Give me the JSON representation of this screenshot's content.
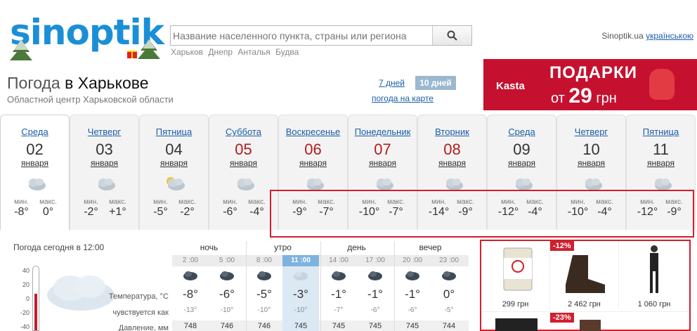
{
  "header": {
    "logo": "sinoptik",
    "search_placeholder": "Название населенного пункта, страны или региона",
    "quick_links": [
      "Харьков",
      "Днепр",
      "Анталья",
      "Будва"
    ],
    "site": "Sinoptik.ua",
    "lang_link": "українською"
  },
  "city": {
    "title_prefix": "Погода",
    "title_main": "в Харькове",
    "subtitle": "Областной центр Харьковской области"
  },
  "tabs": {
    "seven": "7 дней",
    "ten": "10 дней",
    "map": "погода на карте"
  },
  "ad": {
    "brand": "Kasta",
    "title": "ПОДАРКИ",
    "sub_prefix": "от",
    "sub_number": "29",
    "sub_suffix": "грн"
  },
  "days": [
    {
      "name": "Среда",
      "num": "02",
      "month": "января",
      "min": "-8°",
      "max": "0°",
      "red": false
    },
    {
      "name": "Четверг",
      "num": "03",
      "month": "января",
      "min": "-2°",
      "max": "+1°",
      "red": false
    },
    {
      "name": "Пятница",
      "num": "04",
      "month": "января",
      "min": "-5°",
      "max": "-2°",
      "red": false
    },
    {
      "name": "Суббота",
      "num": "05",
      "month": "января",
      "min": "-6°",
      "max": "-4°",
      "red": true
    },
    {
      "name": "Воскресенье",
      "num": "06",
      "month": "января",
      "min": "-9°",
      "max": "-7°",
      "red": true
    },
    {
      "name": "Понедельник",
      "num": "07",
      "month": "января",
      "min": "-10°",
      "max": "-7°",
      "red": true
    },
    {
      "name": "Вторник",
      "num": "08",
      "month": "января",
      "min": "-14°",
      "max": "-9°",
      "red": true
    },
    {
      "name": "Среда",
      "num": "09",
      "month": "января",
      "min": "-12°",
      "max": "-4°",
      "red": false
    },
    {
      "name": "Четверг",
      "num": "10",
      "month": "января",
      "min": "-10°",
      "max": "-4°",
      "red": false
    },
    {
      "name": "Пятница",
      "num": "11",
      "month": "января",
      "min": "-12°",
      "max": "-9°",
      "red": false
    }
  ],
  "min_label": "мин.",
  "max_label": "макс.",
  "today": {
    "label": "Погода сегодня в 12:00",
    "scale": [
      "40",
      "20",
      "0",
      "-20",
      "-40"
    ],
    "periods": [
      "ночь",
      "утро",
      "день",
      "вечер"
    ],
    "rows": {
      "temp": "Температура, °С",
      "feel": "чувствуется как",
      "press": "Давление, мм"
    },
    "hours": [
      {
        "time": "2 :00",
        "temp": "-8°",
        "feel": "-13°",
        "press": "748",
        "active": false
      },
      {
        "time": "5 :00",
        "temp": "-6°",
        "feel": "-10°",
        "press": "746",
        "active": false
      },
      {
        "time": "8 :00",
        "temp": "-5°",
        "feel": "-10°",
        "press": "746",
        "active": false
      },
      {
        "time": "11 :00",
        "temp": "-3°",
        "feel": "-10°",
        "press": "745",
        "active": true
      },
      {
        "time": "14 :00",
        "temp": "-1°",
        "feel": "-7°",
        "press": "745",
        "active": false
      },
      {
        "time": "17 :00",
        "temp": "-1°",
        "feel": "-6°",
        "press": "745",
        "active": false
      },
      {
        "time": "20 :00",
        "temp": "-1°",
        "feel": "-6°",
        "press": "745",
        "active": false
      },
      {
        "time": "23 :00",
        "temp": "0°",
        "feel": "-5°",
        "press": "744",
        "active": false
      }
    ]
  },
  "promo": {
    "items": [
      {
        "price": "299 грн",
        "badge": ""
      },
      {
        "price": "2 462 грн",
        "badge": "-12%"
      },
      {
        "price": "1 060 грн",
        "badge": ""
      }
    ],
    "second_row_badge": "-23%"
  },
  "colors": {
    "accent": "#1a5ea8",
    "holiday": "#b31d1d",
    "highlight": "#d01f2f",
    "logo": "#1b8fd6"
  }
}
